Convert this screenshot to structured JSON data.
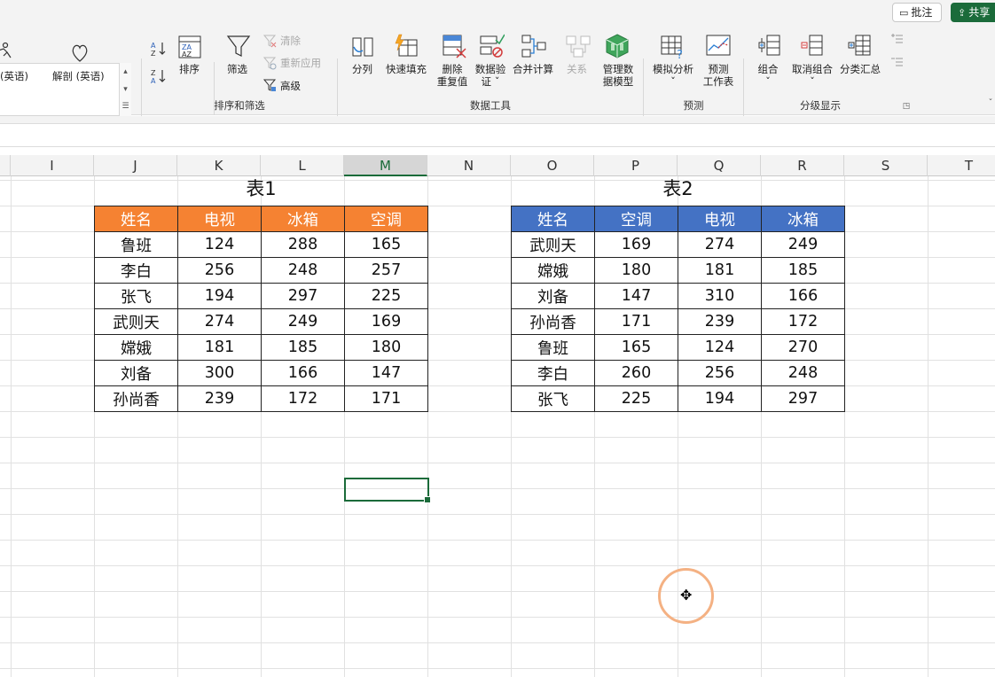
{
  "toolbar": {
    "comment_label": "批注",
    "share_label": "共享"
  },
  "ribbon": {
    "gallery_items": [
      "(英语)",
      "解剖 (英语)"
    ],
    "sort_filter": {
      "sort": "排序",
      "filter": "筛选",
      "clear": "清除",
      "reapply": "重新应用",
      "advanced": "高级",
      "group_label": "排序和筛选"
    },
    "data_tools": {
      "split": "分列",
      "flash_fill": "快速填充",
      "remove_dup_1": "删除",
      "remove_dup_2": "重复值",
      "validate_1": "数据验",
      "validate_2": "证 ˇ",
      "consolidate": "合并计算",
      "relations": "关系",
      "model_1": "管理数",
      "model_2": "据模型",
      "group_label": "数据工具"
    },
    "forecast": {
      "what_if": "模拟分析",
      "what_if_arrow": "ˇ",
      "sheet_1": "预测",
      "sheet_2": "工作表",
      "group_label": "预测"
    },
    "outline": {
      "group": "组合",
      "ungroup": "取消组合",
      "subtotal": "分类汇总",
      "arrow": "ˇ",
      "group_label": "分级显示"
    }
  },
  "columns": [
    "I",
    "J",
    "K",
    "L",
    "M",
    "N",
    "O",
    "P",
    "Q",
    "R",
    "S",
    "T"
  ],
  "selected_column": "M",
  "table1": {
    "title": "表1",
    "headers": [
      "姓名",
      "电视",
      "冰箱",
      "空调"
    ],
    "rows": [
      [
        "鲁班",
        "124",
        "288",
        "165"
      ],
      [
        "李白",
        "256",
        "248",
        "257"
      ],
      [
        "张飞",
        "194",
        "297",
        "225"
      ],
      [
        "武则天",
        "274",
        "249",
        "169"
      ],
      [
        "嫦娥",
        "181",
        "185",
        "180"
      ],
      [
        "刘备",
        "300",
        "166",
        "147"
      ],
      [
        "孙尚香",
        "239",
        "172",
        "171"
      ]
    ],
    "header_color": "#f58232"
  },
  "table2": {
    "title": "表2",
    "headers": [
      "姓名",
      "空调",
      "电视",
      "冰箱"
    ],
    "rows": [
      [
        "武则天",
        "169",
        "274",
        "249"
      ],
      [
        "嫦娥",
        "180",
        "181",
        "185"
      ],
      [
        "刘备",
        "147",
        "310",
        "166"
      ],
      [
        "孙尚香",
        "171",
        "239",
        "172"
      ],
      [
        "鲁班",
        "165",
        "124",
        "270"
      ],
      [
        "李白",
        "260",
        "256",
        "248"
      ],
      [
        "张飞",
        "225",
        "194",
        "297"
      ]
    ],
    "header_color": "#4472c4"
  },
  "colors": {
    "accent": "#1b6b3a",
    "cursor_ring": "#f4b183"
  }
}
